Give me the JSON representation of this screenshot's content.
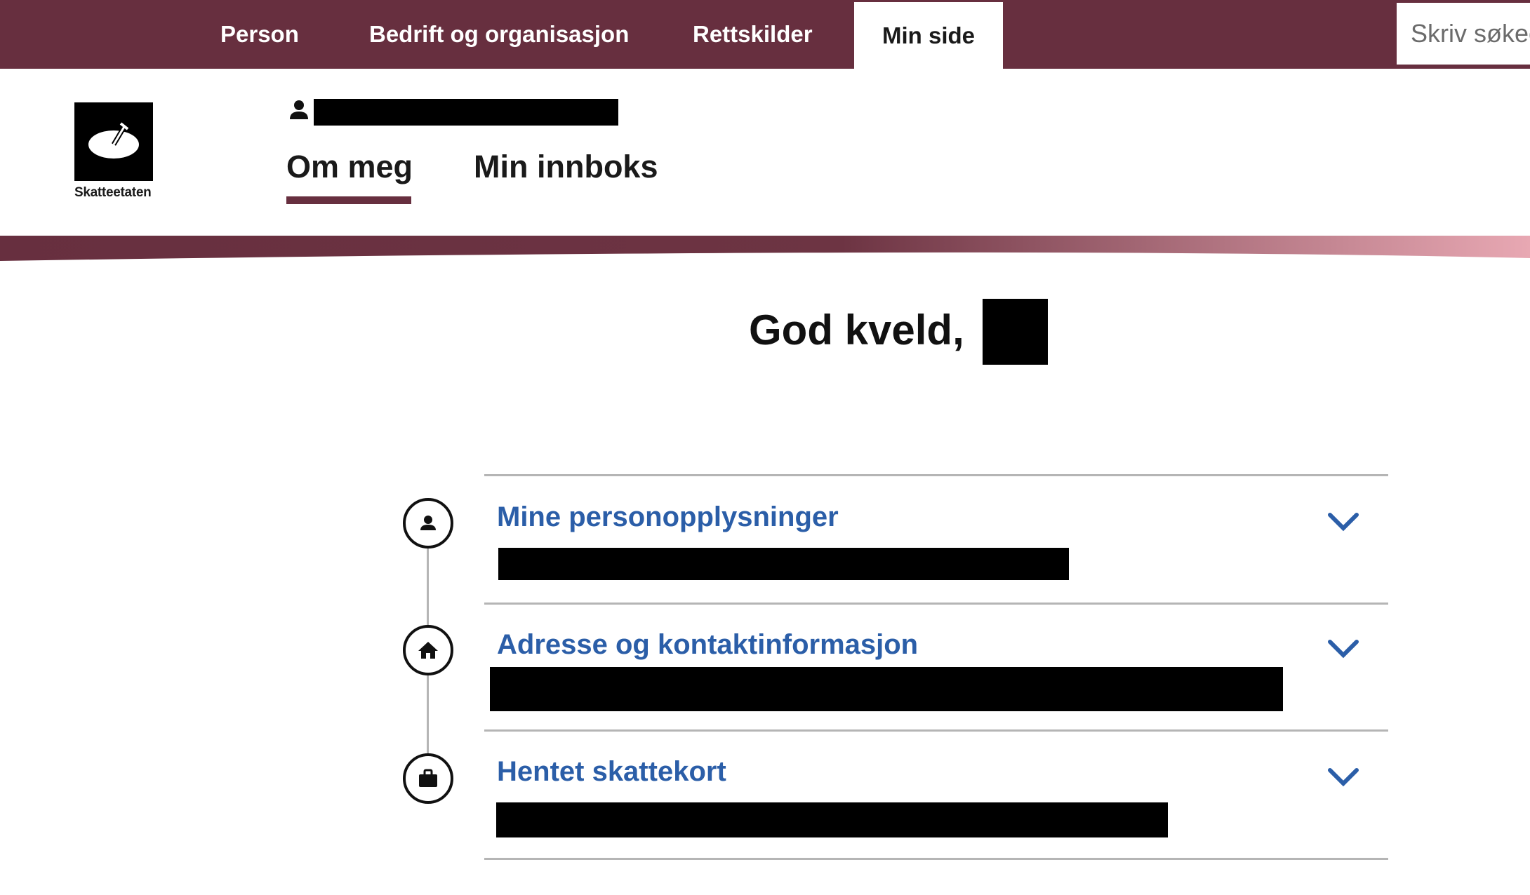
{
  "topnav": {
    "items": [
      "Person",
      "Bedrift og organisasjon",
      "Rettskilder"
    ],
    "active": "Min side"
  },
  "search": {
    "placeholder": "Skriv søkeord"
  },
  "logo": {
    "text": "Skatteetaten"
  },
  "subtabs": [
    "Om meg",
    "Min innboks"
  ],
  "greeting": "God kveld,",
  "sections": [
    {
      "title": "Mine personopplysninger",
      "icon": "person-icon"
    },
    {
      "title": "Adresse og kontaktinformasjon",
      "icon": "home-icon"
    },
    {
      "title": "Hentet skattekort",
      "icon": "briefcase-icon"
    }
  ],
  "colors": {
    "brand": "#672f3f",
    "link": "#2b5ea8",
    "band_fade": "#e8a8b3"
  }
}
